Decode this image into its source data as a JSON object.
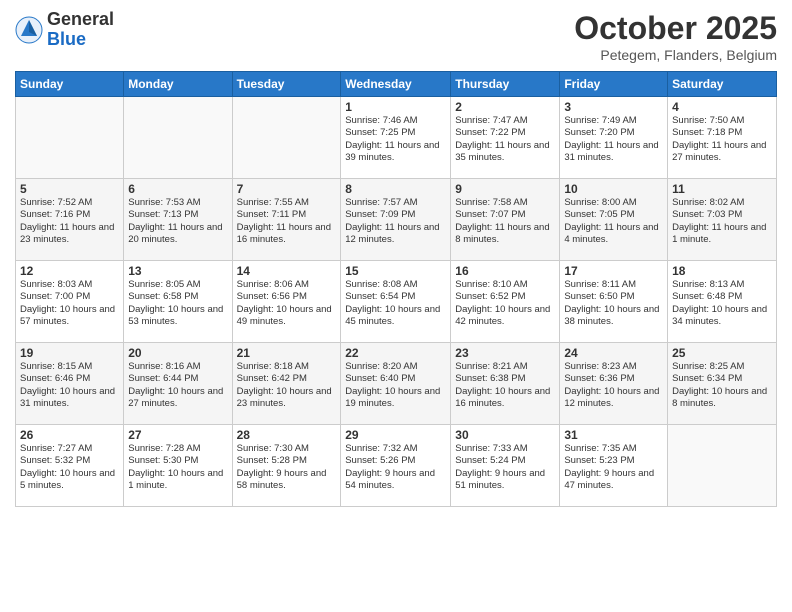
{
  "header": {
    "logo_general": "General",
    "logo_blue": "Blue",
    "month": "October 2025",
    "location": "Petegem, Flanders, Belgium"
  },
  "weekdays": [
    "Sunday",
    "Monday",
    "Tuesday",
    "Wednesday",
    "Thursday",
    "Friday",
    "Saturday"
  ],
  "weeks": [
    [
      {
        "day": "",
        "data": ""
      },
      {
        "day": "",
        "data": ""
      },
      {
        "day": "",
        "data": ""
      },
      {
        "day": "1",
        "data": "Sunrise: 7:46 AM\nSunset: 7:25 PM\nDaylight: 11 hours and 39 minutes."
      },
      {
        "day": "2",
        "data": "Sunrise: 7:47 AM\nSunset: 7:22 PM\nDaylight: 11 hours and 35 minutes."
      },
      {
        "day": "3",
        "data": "Sunrise: 7:49 AM\nSunset: 7:20 PM\nDaylight: 11 hours and 31 minutes."
      },
      {
        "day": "4",
        "data": "Sunrise: 7:50 AM\nSunset: 7:18 PM\nDaylight: 11 hours and 27 minutes."
      }
    ],
    [
      {
        "day": "5",
        "data": "Sunrise: 7:52 AM\nSunset: 7:16 PM\nDaylight: 11 hours and 23 minutes."
      },
      {
        "day": "6",
        "data": "Sunrise: 7:53 AM\nSunset: 7:13 PM\nDaylight: 11 hours and 20 minutes."
      },
      {
        "day": "7",
        "data": "Sunrise: 7:55 AM\nSunset: 7:11 PM\nDaylight: 11 hours and 16 minutes."
      },
      {
        "day": "8",
        "data": "Sunrise: 7:57 AM\nSunset: 7:09 PM\nDaylight: 11 hours and 12 minutes."
      },
      {
        "day": "9",
        "data": "Sunrise: 7:58 AM\nSunset: 7:07 PM\nDaylight: 11 hours and 8 minutes."
      },
      {
        "day": "10",
        "data": "Sunrise: 8:00 AM\nSunset: 7:05 PM\nDaylight: 11 hours and 4 minutes."
      },
      {
        "day": "11",
        "data": "Sunrise: 8:02 AM\nSunset: 7:03 PM\nDaylight: 11 hours and 1 minute."
      }
    ],
    [
      {
        "day": "12",
        "data": "Sunrise: 8:03 AM\nSunset: 7:00 PM\nDaylight: 10 hours and 57 minutes."
      },
      {
        "day": "13",
        "data": "Sunrise: 8:05 AM\nSunset: 6:58 PM\nDaylight: 10 hours and 53 minutes."
      },
      {
        "day": "14",
        "data": "Sunrise: 8:06 AM\nSunset: 6:56 PM\nDaylight: 10 hours and 49 minutes."
      },
      {
        "day": "15",
        "data": "Sunrise: 8:08 AM\nSunset: 6:54 PM\nDaylight: 10 hours and 45 minutes."
      },
      {
        "day": "16",
        "data": "Sunrise: 8:10 AM\nSunset: 6:52 PM\nDaylight: 10 hours and 42 minutes."
      },
      {
        "day": "17",
        "data": "Sunrise: 8:11 AM\nSunset: 6:50 PM\nDaylight: 10 hours and 38 minutes."
      },
      {
        "day": "18",
        "data": "Sunrise: 8:13 AM\nSunset: 6:48 PM\nDaylight: 10 hours and 34 minutes."
      }
    ],
    [
      {
        "day": "19",
        "data": "Sunrise: 8:15 AM\nSunset: 6:46 PM\nDaylight: 10 hours and 31 minutes."
      },
      {
        "day": "20",
        "data": "Sunrise: 8:16 AM\nSunset: 6:44 PM\nDaylight: 10 hours and 27 minutes."
      },
      {
        "day": "21",
        "data": "Sunrise: 8:18 AM\nSunset: 6:42 PM\nDaylight: 10 hours and 23 minutes."
      },
      {
        "day": "22",
        "data": "Sunrise: 8:20 AM\nSunset: 6:40 PM\nDaylight: 10 hours and 19 minutes."
      },
      {
        "day": "23",
        "data": "Sunrise: 8:21 AM\nSunset: 6:38 PM\nDaylight: 10 hours and 16 minutes."
      },
      {
        "day": "24",
        "data": "Sunrise: 8:23 AM\nSunset: 6:36 PM\nDaylight: 10 hours and 12 minutes."
      },
      {
        "day": "25",
        "data": "Sunrise: 8:25 AM\nSunset: 6:34 PM\nDaylight: 10 hours and 8 minutes."
      }
    ],
    [
      {
        "day": "26",
        "data": "Sunrise: 7:27 AM\nSunset: 5:32 PM\nDaylight: 10 hours and 5 minutes."
      },
      {
        "day": "27",
        "data": "Sunrise: 7:28 AM\nSunset: 5:30 PM\nDaylight: 10 hours and 1 minute."
      },
      {
        "day": "28",
        "data": "Sunrise: 7:30 AM\nSunset: 5:28 PM\nDaylight: 9 hours and 58 minutes."
      },
      {
        "day": "29",
        "data": "Sunrise: 7:32 AM\nSunset: 5:26 PM\nDaylight: 9 hours and 54 minutes."
      },
      {
        "day": "30",
        "data": "Sunrise: 7:33 AM\nSunset: 5:24 PM\nDaylight: 9 hours and 51 minutes."
      },
      {
        "day": "31",
        "data": "Sunrise: 7:35 AM\nSunset: 5:23 PM\nDaylight: 9 hours and 47 minutes."
      },
      {
        "day": "",
        "data": ""
      }
    ]
  ]
}
